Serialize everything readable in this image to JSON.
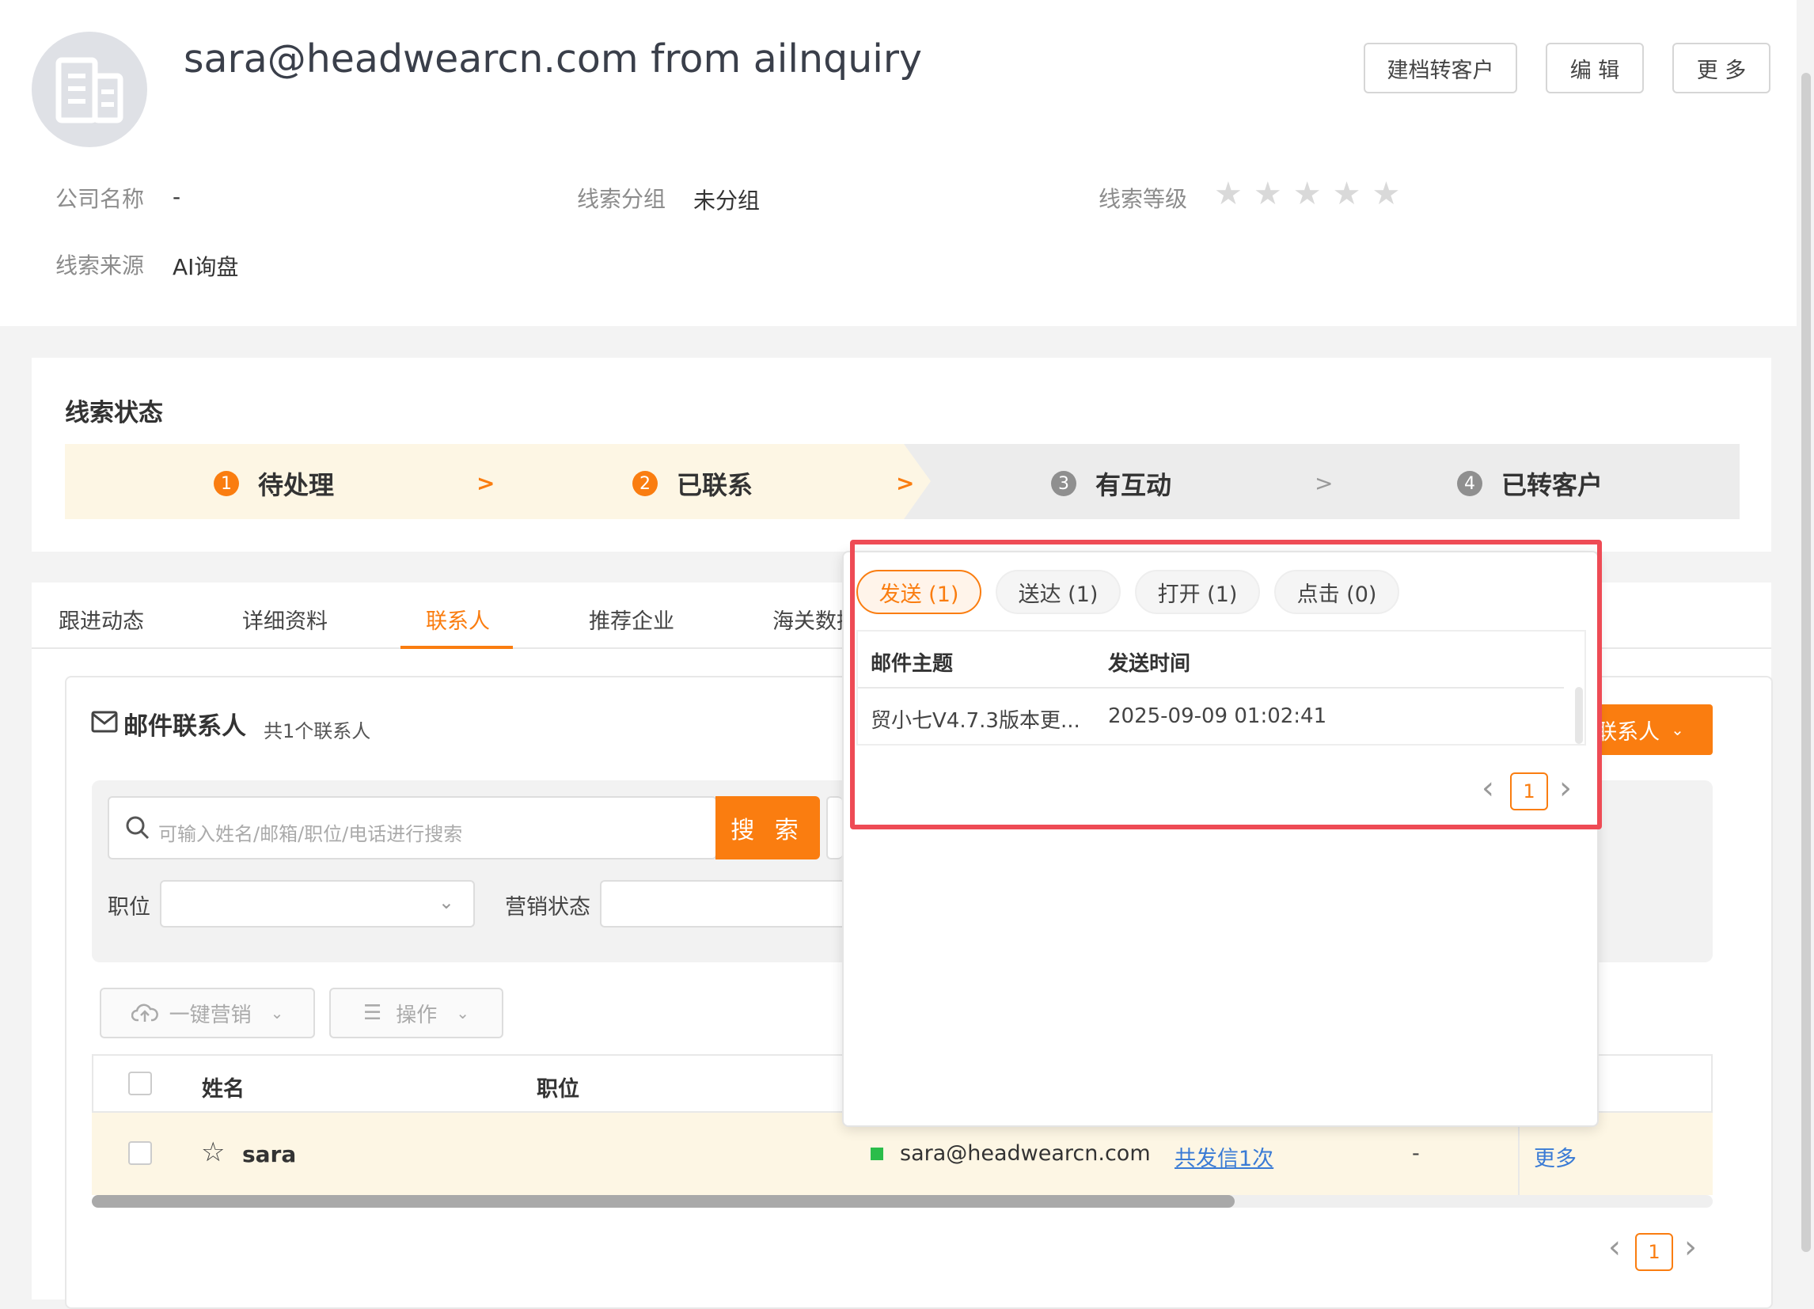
{
  "header": {
    "title": "sara@headwearcn.com from ailnquiry",
    "buttons": {
      "archive": "建档转客户",
      "edit": "编 辑",
      "more": "更 多"
    },
    "fields": {
      "company_label": "公司名称",
      "company_value": "-",
      "group_label": "线索分组",
      "group_value": "未分组",
      "level_label": "线索等级",
      "level_stars": 0,
      "source_label": "线索来源",
      "source_value": "AI询盘"
    }
  },
  "status": {
    "title": "线索状态",
    "steps": [
      {
        "num": "1",
        "label": "待处理"
      },
      {
        "num": "2",
        "label": "已联系"
      },
      {
        "num": "3",
        "label": "有互动"
      },
      {
        "num": "4",
        "label": "已转客户"
      }
    ],
    "arrow": ">"
  },
  "tabs": {
    "items": [
      "跟进动态",
      "详细资料",
      "联系人",
      "推荐企业",
      "海关数据"
    ],
    "active": "联系人"
  },
  "contacts": {
    "title": "邮件联系人",
    "count_text": "共1个联系人",
    "add_button": "联系人",
    "search_placeholder": "可输入姓名/邮箱/职位/电话进行搜索",
    "search_button": "搜 索",
    "filter_position_label": "职位",
    "filter_marketing_label": "营销状态",
    "bulk_marketing": "一键营销",
    "operation": "操作",
    "table": {
      "headers": {
        "name": "姓名",
        "position": "职位"
      },
      "rows": [
        {
          "name": "sara",
          "email": "sara@headwearcn.com",
          "sent": "共发信1次",
          "dash": "-",
          "more": "更多"
        }
      ]
    },
    "page": "1"
  },
  "popup": {
    "pills": [
      "发送 (1)",
      "送达 (1)",
      "打开 (1)",
      "点击 (0)"
    ],
    "active_pill": "发送 (1)",
    "headers": {
      "subject": "邮件主题",
      "time": "发送时间"
    },
    "rows": [
      {
        "subject": "贸小七V4.7.3版本更...",
        "time": "2025-09-09 01:02:41"
      }
    ],
    "page": "1"
  },
  "colors": {
    "accent": "#fa7d10",
    "highlight": "#ee4b55",
    "link": "#3a7bd5"
  }
}
